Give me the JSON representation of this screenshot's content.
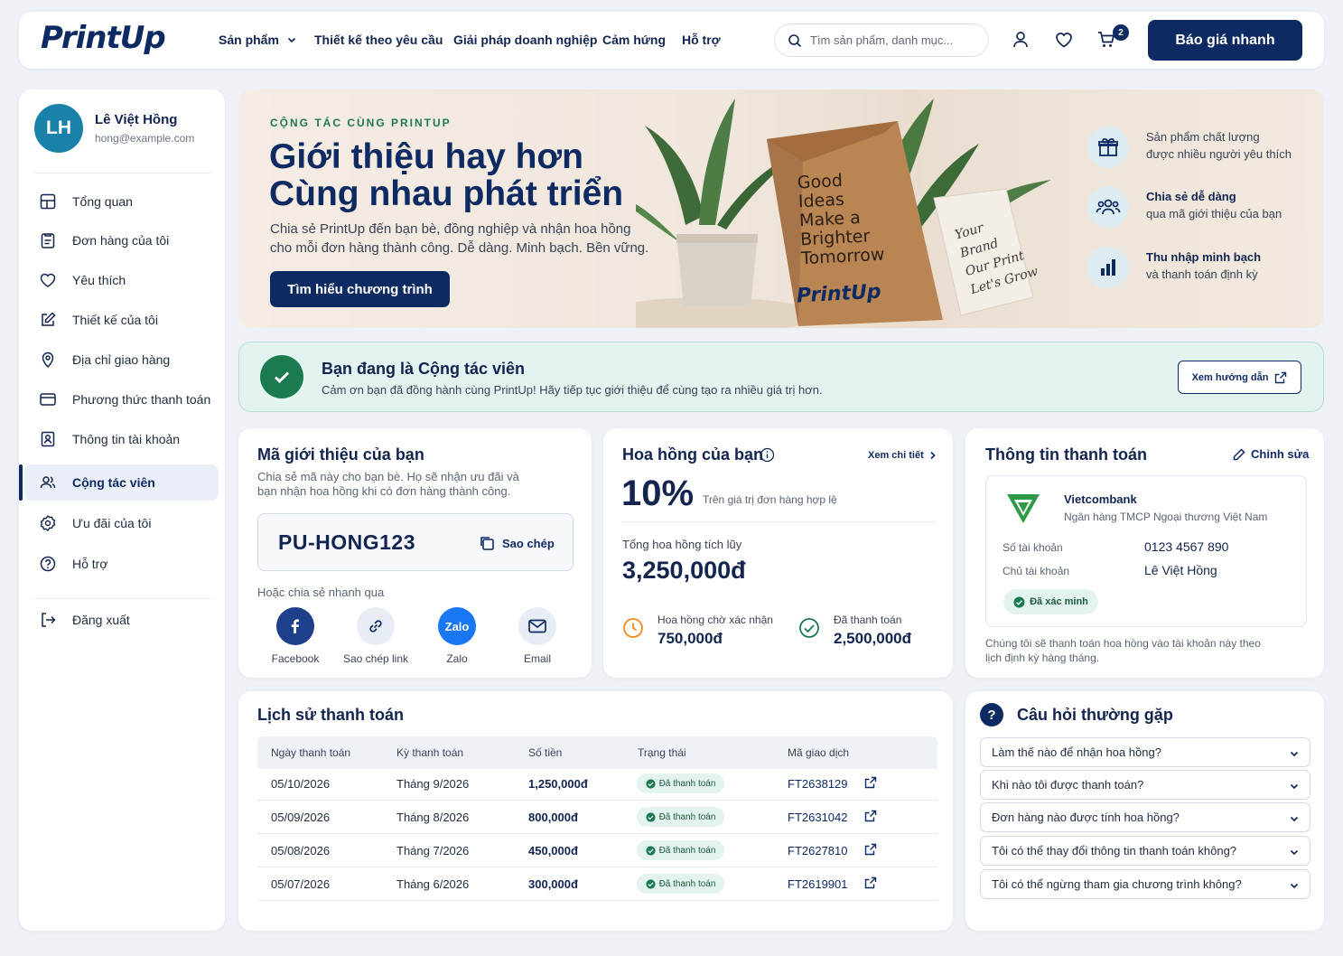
{
  "brand": {
    "logo_text": "PrintUp",
    "primary_color": "#0e2a63",
    "accent_green": "#1b7a50"
  },
  "topbar": {
    "nav": [
      "Sản phẩm",
      "Thiết kế theo yêu cầu",
      "Giải pháp doanh nghiệp",
      "Cảm hứng",
      "Hỗ trợ"
    ],
    "search_placeholder": "Tìm sản phẩm, danh mục...",
    "cart_count": "2",
    "quote_button": "Báo giá nhanh"
  },
  "user": {
    "initials": "LH",
    "name": "Lê Việt Hồng",
    "email": "hong@example.com"
  },
  "sidebar": {
    "items": [
      {
        "label": "Tổng quan",
        "icon": "grid-icon"
      },
      {
        "label": "Đơn hàng của tôi",
        "icon": "orders-icon"
      },
      {
        "label": "Yêu thích",
        "icon": "heart-icon"
      },
      {
        "label": "Thiết kế của tôi",
        "icon": "edit-icon"
      },
      {
        "label": "Địa chỉ giao hàng",
        "icon": "location-icon"
      },
      {
        "label": "Phương thức thanh toán",
        "icon": "card-icon"
      },
      {
        "label": "Thông tin tài khoản",
        "icon": "account-icon"
      },
      {
        "label": "Cộng tác viên",
        "icon": "users-icon",
        "active": true
      },
      {
        "label": "Ưu đãi của tôi",
        "icon": "badge-icon"
      },
      {
        "label": "Hỗ trợ",
        "icon": "help-icon"
      }
    ],
    "logout": "Đăng xuất"
  },
  "hero": {
    "eyebrow": "CỘNG TÁC CÙNG PRINTUP",
    "title_line1": "Giới thiệu hay hơn",
    "title_line2": "Cùng nhau phát triển",
    "subtitle": "Chia sẻ PrintUp đến bạn bè, đồng nghiệp và nhận hoa hồng cho mỗi đơn hàng thành công. Dễ dàng. Minh bạch. Bền vững.",
    "button": "Tìm hiểu chương trình",
    "bag_text": [
      "Good",
      "Ideas",
      "Make a",
      "Brighter",
      "Tomorrow"
    ],
    "bag_logo": "PrintUp",
    "card_text": [
      "Your",
      "Brand",
      "Our Print",
      "Let's Grow"
    ],
    "features": [
      {
        "line1": "Sản phẩm chất lượng",
        "line2": "được nhiều người yêu thích",
        "icon": "gift-icon"
      },
      {
        "line1": "Chia sẻ dễ dàng",
        "line2": "qua mã giới thiệu của bạn",
        "icon": "people-icon"
      },
      {
        "line1": "Thu nhập minh bạch",
        "line2": "và thanh toán định kỳ",
        "icon": "bar-chart-icon"
      }
    ]
  },
  "status": {
    "title": "Bạn đang là Cộng tác viên",
    "message": "Cảm ơn bạn đã đồng hành cùng PrintUp! Hãy tiếp tục giới thiệu để cùng tạo ra nhiều giá trị hơn.",
    "guide_button": "Xem hướng dẫn"
  },
  "referral": {
    "title": "Mã giới thiệu của bạn",
    "description_line1": "Chia sẻ mã này cho bạn bè. Họ sẽ nhận ưu đãi và",
    "description_line2": "bạn nhận hoa hồng khi có đơn hàng thành công.",
    "code": "PU-HONG123",
    "copy_label": "Sao chép",
    "share_label": "Hoặc chia sẻ nhanh qua",
    "share": [
      {
        "label": "Facebook",
        "color": "#1e3f8a"
      },
      {
        "label": "Sao chép link",
        "color": "#e8edf5"
      },
      {
        "label": "Zalo",
        "color": "#1877f2",
        "glyph": "Zalo"
      },
      {
        "label": "Email",
        "color": "#e8edf5"
      }
    ]
  },
  "commission": {
    "title": "Hoa hồng của bạn",
    "details_link": "Xem chi tiết",
    "rate": "10%",
    "rate_note": "Trên giá trị đơn hàng hợp lệ",
    "total_label": "Tổng hoa hồng tích lũy",
    "total": "3,250,000đ",
    "pending_label": "Hoa hồng chờ xác nhận",
    "pending": "750,000đ",
    "paid_label": "Đã thanh toán",
    "paid": "2,500,000đ"
  },
  "payment_info": {
    "title": "Thông tin thanh toán",
    "edit": "Chỉnh sửa",
    "bank": "Vietcombank",
    "bank_full": "Ngân hàng TMCP Ngoại thương Việt Nam",
    "account_no_label": "Số tài khoản",
    "account_no": "0123 4567 890",
    "holder_label": "Chủ tài khoản",
    "holder": "Lê Việt Hồng",
    "verified": "Đã xác minh",
    "note_line1": "Chúng tôi sẽ thanh toán hoa hồng vào tài khoản này theo",
    "note_line2": "lịch định kỳ hàng tháng."
  },
  "history": {
    "title": "Lịch sử thanh toán",
    "columns": [
      "Ngày thanh toán",
      "Kỳ thanh toán",
      "Số tiền",
      "Trạng thái",
      "Mã giao dịch"
    ],
    "rows": [
      {
        "date": "05/10/2026",
        "period": "Tháng 9/2026",
        "amount": "1,250,000đ",
        "status": "Đã thanh toán",
        "txn": "FT2638129"
      },
      {
        "date": "05/09/2026",
        "period": "Tháng 8/2026",
        "amount": "800,000đ",
        "status": "Đã thanh toán",
        "txn": "FT2631042"
      },
      {
        "date": "05/08/2026",
        "period": "Tháng 7/2026",
        "amount": "450,000đ",
        "status": "Đã thanh toán",
        "txn": "FT2627810"
      },
      {
        "date": "05/07/2026",
        "period": "Tháng 6/2026",
        "amount": "300,000đ",
        "status": "Đã thanh toán",
        "txn": "FT2619901"
      }
    ]
  },
  "faq": {
    "title": "Câu hỏi thường gặp",
    "questions": [
      "Làm thế nào để nhận hoa hồng?",
      "Khi nào tôi được thanh toán?",
      "Đơn hàng nào được tính hoa hồng?",
      "Tôi có thể thay đổi thông tin thanh toán không?",
      "Tôi có thể ngừng tham gia chương trình không?"
    ]
  }
}
